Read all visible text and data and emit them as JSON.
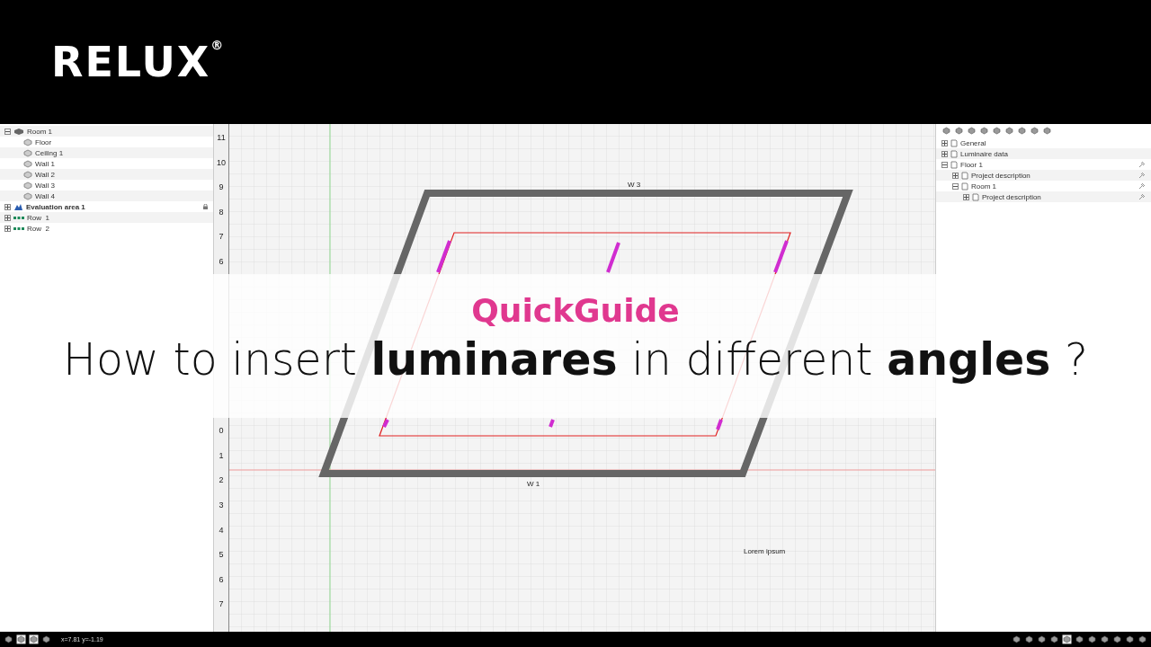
{
  "header": {
    "logo": "RELUX$^{®}$"
  },
  "scene_tree": [
    {
      "label": "Room 1",
      "kind": "room",
      "bold": false,
      "expanded": true,
      "children": [
        {
          "label": "Floor",
          "kind": "surface"
        },
        {
          "label": "Ceiling 1",
          "kind": "surface"
        },
        {
          "label": "Wall 1",
          "kind": "surface"
        },
        {
          "label": "Wall 2",
          "kind": "surface"
        },
        {
          "label": "Wall 3",
          "kind": "surface"
        },
        {
          "label": "Wall 4",
          "kind": "surface"
        }
      ]
    },
    {
      "label": "Evaluation area 1",
      "kind": "area",
      "bold": true,
      "expanded": false,
      "locked": true
    },
    {
      "label": "Row  1",
      "kind": "row",
      "bold": false,
      "expanded": false
    },
    {
      "label": "Row  2",
      "kind": "row",
      "bold": false,
      "expanded": false
    }
  ],
  "ruler": {
    "upper": [
      "11",
      "10",
      "9",
      "8",
      "7",
      "6"
    ],
    "lower": [
      "0",
      "1",
      "2",
      "3",
      "4",
      "5",
      "6",
      "7"
    ]
  },
  "plan": {
    "wall_labels": [
      "W 3",
      "W 1"
    ],
    "note": "Lorem ipsum"
  },
  "project_tree": [
    {
      "label": "General",
      "expanded": false,
      "pinned": false
    },
    {
      "label": "Luminaire data",
      "expanded": false,
      "pinned": false
    },
    {
      "label": "Floor 1",
      "expanded": true,
      "pinned": true,
      "children": [
        {
          "label": "Project description",
          "expanded": false,
          "pinned": true
        },
        {
          "label": "Room 1",
          "expanded": true,
          "pinned": true,
          "children": [
            {
              "label": "Project description",
              "expanded": false,
              "pinned": true
            }
          ]
        }
      ]
    }
  ],
  "overlay": {
    "title": "QuickGuide",
    "headline": "How to insert **luminares** in different **angles** ?"
  },
  "status_bar": {
    "coordinates": "x=7.81 y=-1.19"
  }
}
